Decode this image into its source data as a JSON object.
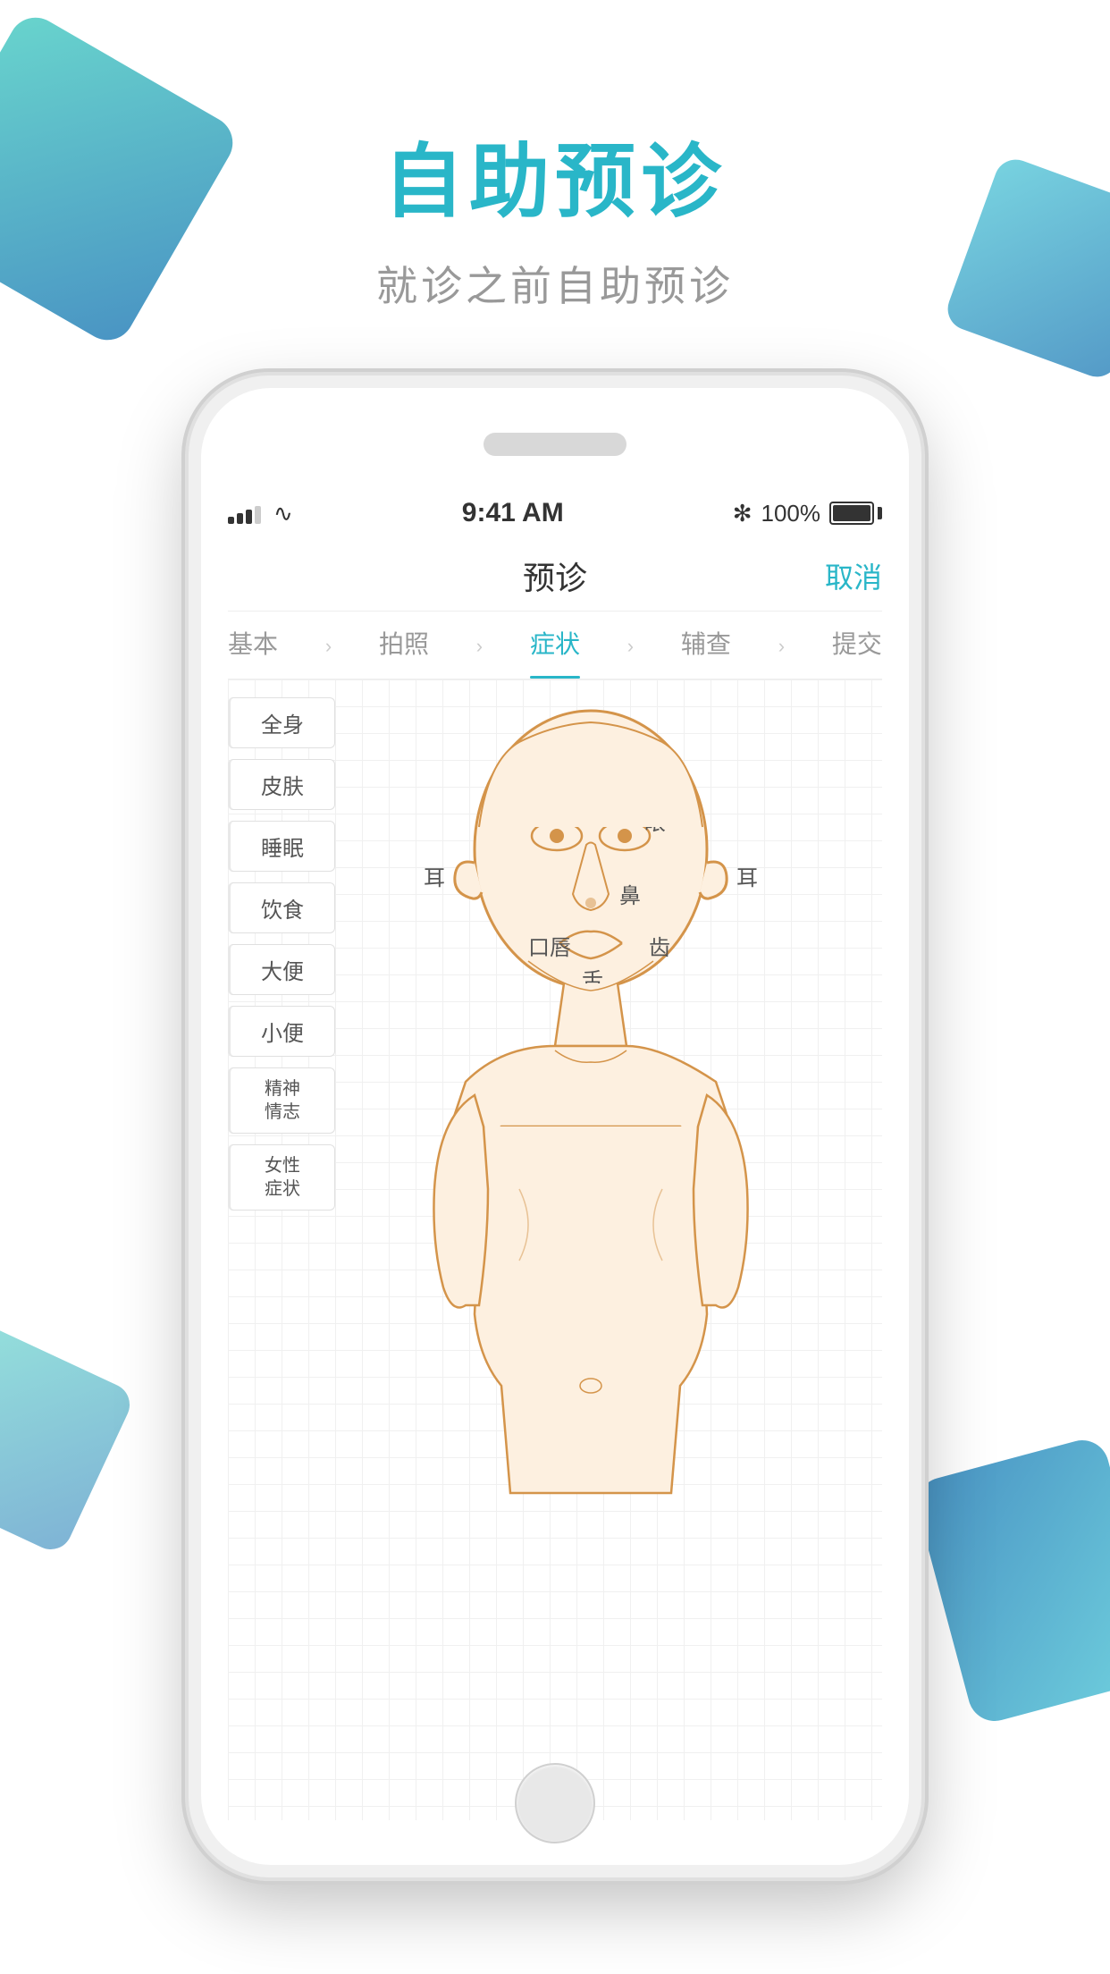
{
  "page": {
    "main_title": "自助预诊",
    "subtitle": "就诊之前自助预诊"
  },
  "status_bar": {
    "time": "9:41 AM",
    "battery_percent": "100%",
    "bluetooth": "✻"
  },
  "nav": {
    "title": "预诊",
    "cancel_label": "取消"
  },
  "steps": [
    {
      "label": "基本",
      "active": false
    },
    {
      "label": "拍照",
      "active": false
    },
    {
      "label": "症状",
      "active": true
    },
    {
      "label": "辅查",
      "active": false
    },
    {
      "label": "提交",
      "active": false
    }
  ],
  "sidebar": {
    "items": [
      {
        "label": "全身"
      },
      {
        "label": "皮肤"
      },
      {
        "label": "睡眠"
      },
      {
        "label": "饮食"
      },
      {
        "label": "大便"
      },
      {
        "label": "小便"
      },
      {
        "label": "精神\n情志"
      },
      {
        "label": "女性\n症状"
      }
    ]
  },
  "body_labels": {
    "eye": "眼",
    "ear_left": "耳",
    "ear_right": "耳",
    "nose": "鼻",
    "mouth_lip": "口唇",
    "tooth": "齿",
    "tongue": "舌"
  },
  "colors": {
    "primary": "#29b6c8",
    "body_stroke": "#d4944a",
    "body_fill": "#fdf0e0",
    "accent_teal": "#4ecdc4",
    "accent_blue": "#2980b9"
  }
}
